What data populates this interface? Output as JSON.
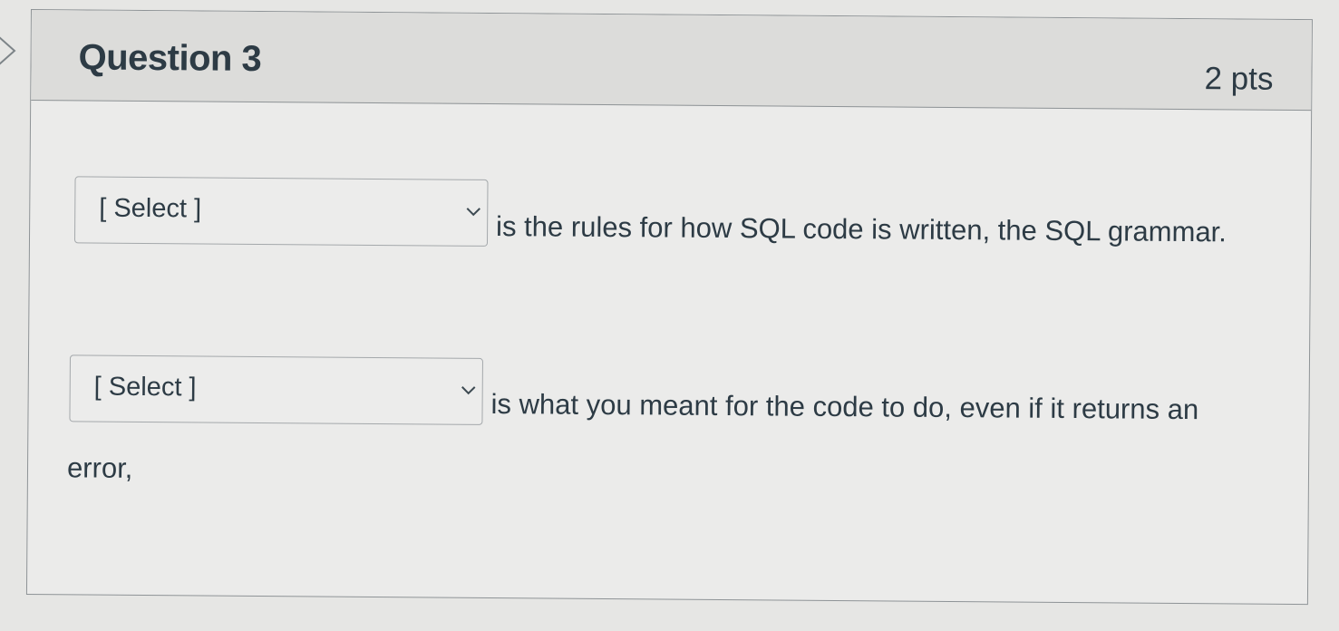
{
  "question": {
    "title": "Question 3",
    "points": "2 pts"
  },
  "statements": [
    {
      "select_value": "[ Select ]",
      "text": "is the rules for how SQL code is written, the SQL grammar."
    },
    {
      "select_value": "[ Select ]",
      "text": "is what you meant for the code to do, even if it returns an",
      "continuation": "error,"
    }
  ],
  "icons": {
    "dropdown": "chevron-down-icon",
    "nav": "chevron-right-icon"
  },
  "colors": {
    "text": "#2d3b45",
    "header_bg": "#dcdcda",
    "border": "#8e9396"
  }
}
